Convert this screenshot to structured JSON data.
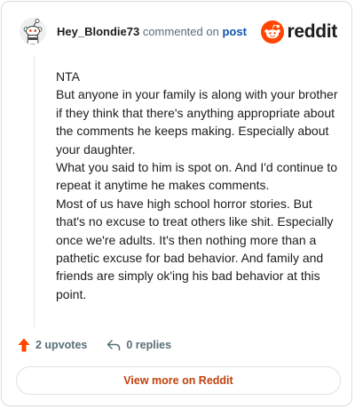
{
  "header": {
    "username": "Hey_Blondie73",
    "commented_text": "commented on",
    "post_link": "post",
    "brand_name": "reddit",
    "brand_color": "#ff4500",
    "avatar_icon": "snoo-avatar-icon"
  },
  "comment": {
    "paragraphs": [
      "NTA",
      "But anyone in your family is along with your brother if they think that there's anything appropriate about the comments he keeps making. Especially about your daughter.",
      "What you said to him is spot on. And I'd continue to repeat it anytime he makes comments.",
      "Most of us have high school horror stories. But that's no excuse to treat others like shit. Especially once we're adults. It's then nothing more than a pathetic excuse for bad behavior. And family and friends are simply ok'ing his bad behavior at this point."
    ]
  },
  "actions": {
    "upvotes_label": "2 upvotes",
    "upvote_icon": "upvote-arrow-icon",
    "upvote_color": "#ff4500",
    "replies_label": "0 replies",
    "reply_icon": "reply-arrow-icon"
  },
  "footer": {
    "view_more_label": "View more on Reddit",
    "view_more_color": "#c2410c"
  }
}
